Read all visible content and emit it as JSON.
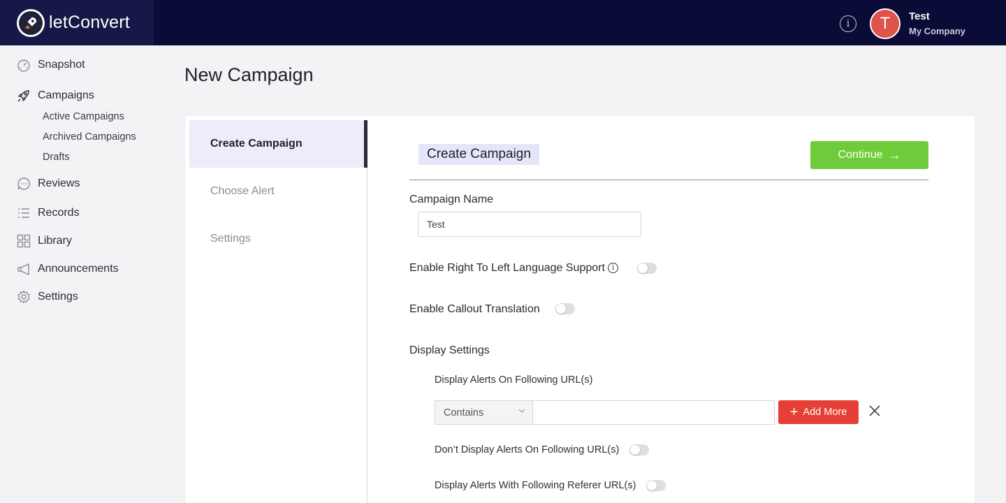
{
  "app": {
    "logo_text_light": "let",
    "logo_text_bold": "Convert"
  },
  "header": {
    "user_initial": "T",
    "user_name": "Test",
    "company": "My Company"
  },
  "sidebar": {
    "items": [
      {
        "label": "Snapshot",
        "icon": "gauge-icon"
      },
      {
        "label": "Campaigns",
        "icon": "rocket-icon"
      },
      {
        "label": "Reviews",
        "icon": "chat-bubble-icon"
      },
      {
        "label": "Records",
        "icon": "list-icon"
      },
      {
        "label": "Library",
        "icon": "grid-icon"
      },
      {
        "label": "Announcements",
        "icon": "megaphone-icon"
      },
      {
        "label": "Settings",
        "icon": "gear-icon"
      }
    ],
    "campaign_subitems": [
      "Active Campaigns",
      "Archived Campaigns",
      "Drafts"
    ]
  },
  "page": {
    "title": "New Campaign"
  },
  "steps": [
    "Create Campaign",
    "Choose Alert",
    "Settings"
  ],
  "form": {
    "section_title": "Create Campaign",
    "continue_label": "Continue",
    "campaign_name_label": "Campaign Name",
    "campaign_name_value": "Test",
    "rtl_label": "Enable Right To Left Language Support",
    "rtl_enabled": false,
    "callout_label": "Enable Callout Translation",
    "callout_enabled": false,
    "display_settings_label": "Display Settings",
    "display_on_urls_label": "Display Alerts On Following URL(s)",
    "match_type": "Contains",
    "url_value": "",
    "add_more_label": "Add More",
    "dont_display_label": "Don’t Display Alerts On Following URL(s)",
    "dont_display_enabled": false,
    "referer_label": "Display Alerts With Following Referer URL(s)",
    "referer_enabled": false
  },
  "colors": {
    "topbar": "#0a0b37",
    "continue": "#6fcb3a",
    "add_more": "#e53f36",
    "avatar": "#e0524a"
  }
}
